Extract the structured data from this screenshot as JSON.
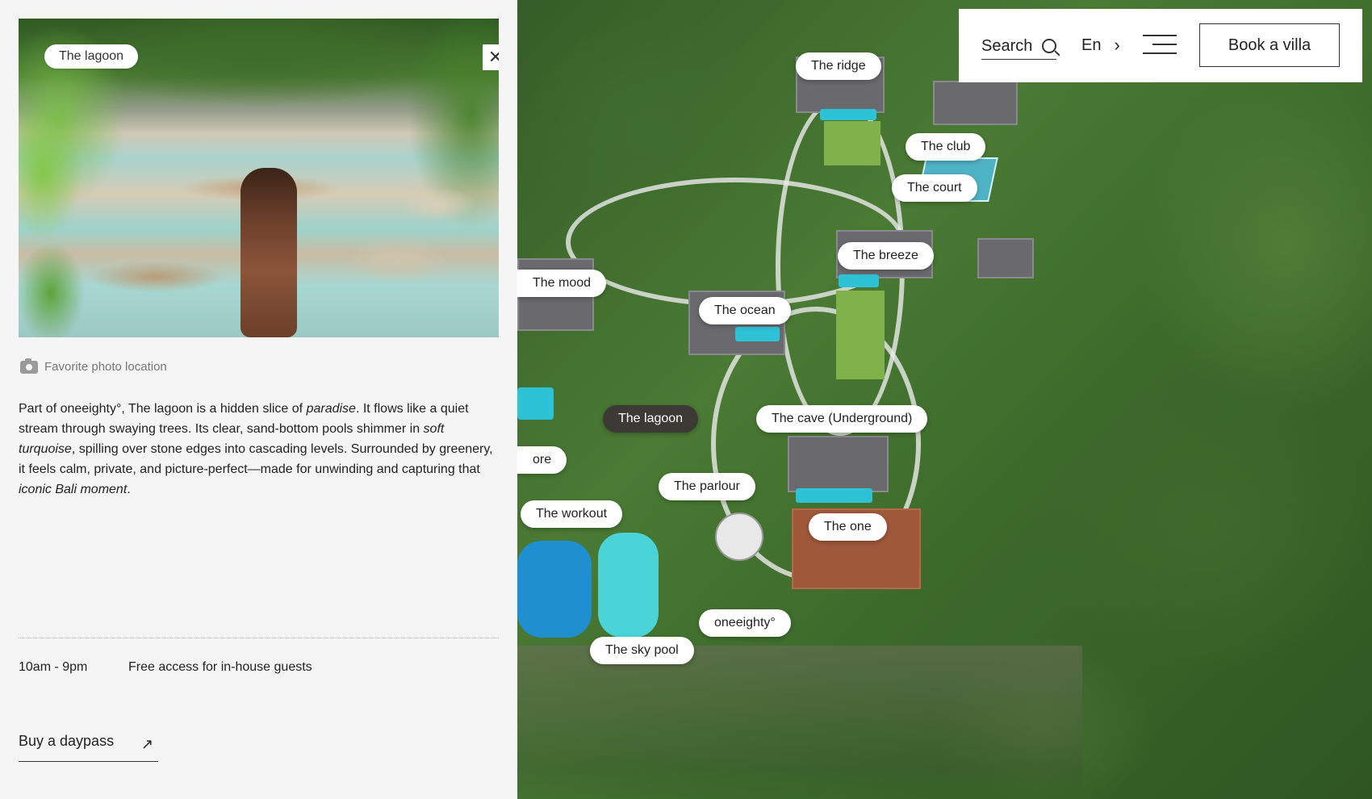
{
  "panel": {
    "photo_label": "The lagoon",
    "close_symbol": "✕",
    "location_label": "Favorite photo location",
    "description": {
      "p1": "Part of oneeighty°, The lagoon is a hidden slice of ",
      "e1": "paradise",
      "p2": ". It flows like a quiet stream through swaying trees. Its clear, sand-bottom pools shimmer in ",
      "e2": "soft turquoise",
      "p3": ", spilling over stone edges into cascading levels. Surrounded by greenery, it feels calm, private, and picture-perfect—made for unwinding and capturing that ",
      "e3": "iconic Bali moment",
      "p4": "."
    },
    "hours": "10am - 9pm",
    "access": "Free access for in-house guests",
    "daypass_label": "Buy a daypass",
    "daypass_icon": "↗"
  },
  "topbar": {
    "search_label": "Search",
    "language": "En",
    "language_chevron": "›",
    "book_label": "Book a villa"
  },
  "map": {
    "active": "The lagoon",
    "locations": [
      "The ridge",
      "The club",
      "The court",
      "The breeze",
      "The mood",
      "The ocean",
      "The lagoon",
      "The cave (Underground)",
      "ore",
      "The parlour",
      "The workout",
      "The one",
      "oneeighty°",
      "The sky pool"
    ]
  },
  "colors": {
    "panel_bg": "#f5f5f5",
    "active_chip": "#3d3a36",
    "chip": "#ffffff"
  }
}
